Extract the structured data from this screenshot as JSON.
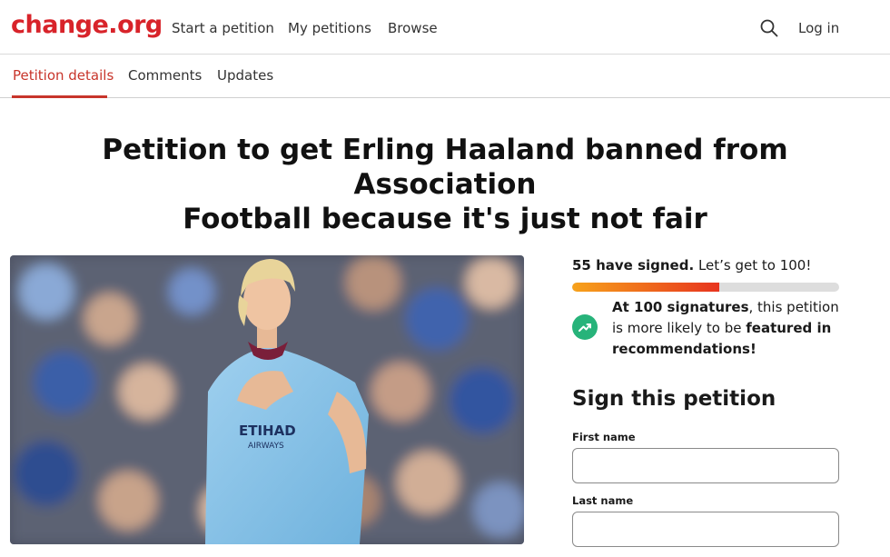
{
  "brand": {
    "logo_text": "change.org",
    "accent": "#d8232a",
    "tab_accent": "#c8352b",
    "success": "#27b37a"
  },
  "topnav": {
    "links": [
      "Start a petition",
      "My petitions",
      "Browse"
    ],
    "search_icon": "search-icon",
    "login_label": "Log in"
  },
  "tabs": [
    {
      "label": "Petition details",
      "active": true
    },
    {
      "label": "Comments",
      "active": false
    },
    {
      "label": "Updates",
      "active": false
    }
  ],
  "petition": {
    "title_line1": "Petition to get Erling Haaland banned from Association",
    "title_line2": "Football because it's just not fair",
    "image_description": "footballer-photo"
  },
  "signatures": {
    "count_text": "55 have signed.",
    "goal_text": " Let’s get to 100!",
    "progress_fraction": 0.55,
    "promo_bold_1": "At 100 signatures",
    "promo_text_1": ", this petition is more likely to be ",
    "promo_bold_2": "featured in recommendations!"
  },
  "sign_form": {
    "heading": "Sign this petition",
    "first_name_label": "First name",
    "first_name_value": "",
    "last_name_label": "Last name",
    "last_name_value": ""
  }
}
